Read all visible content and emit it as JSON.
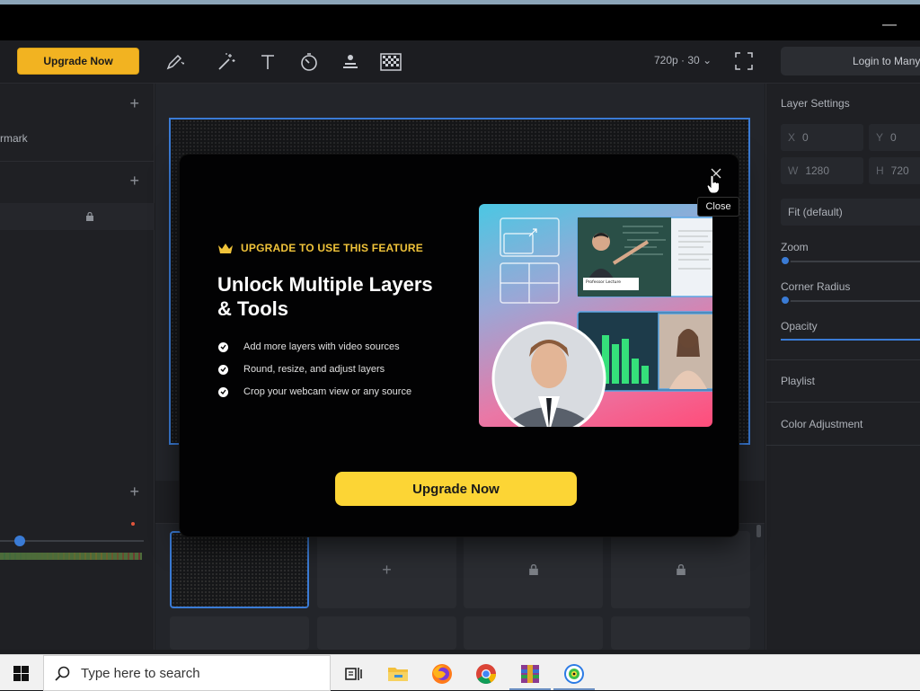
{
  "toolbar": {
    "upgrade_label": "Upgrade Now",
    "resolution": "720p · 30",
    "login_label": "Login to Manycam"
  },
  "left_panel": {
    "item_watermark": "rmark"
  },
  "right_panel": {
    "layer_settings": "Layer Settings",
    "x_key": "X",
    "x_val": "0",
    "y_key": "Y",
    "y_val": "0",
    "w_key": "W",
    "w_val": "1280",
    "h_key": "H",
    "h_val": "720",
    "fit": "Fit (default)",
    "zoom": "Zoom",
    "corner_radius": "Corner Radius",
    "opacity": "Opacity",
    "playlist": "Playlist",
    "color_adjustment": "Color Adjustment"
  },
  "modal": {
    "eyebrow": "UPGRADE TO USE THIS FEATURE",
    "headline": "Unlock Multiple Layers & Tools",
    "features": [
      "Add more layers with video sources",
      "Round, resize, and adjust layers",
      "Crop your webcam view or any source"
    ],
    "cta": "Upgrade Now",
    "close_tooltip": "Close",
    "illustration_caption": "Professor Lecture"
  },
  "taskbar": {
    "search_placeholder": "Type here to search"
  },
  "colors": {
    "accent_blue": "#3a7bd5",
    "upgrade_yellow": "#fcd535",
    "crown_gold": "#f0c33a"
  }
}
